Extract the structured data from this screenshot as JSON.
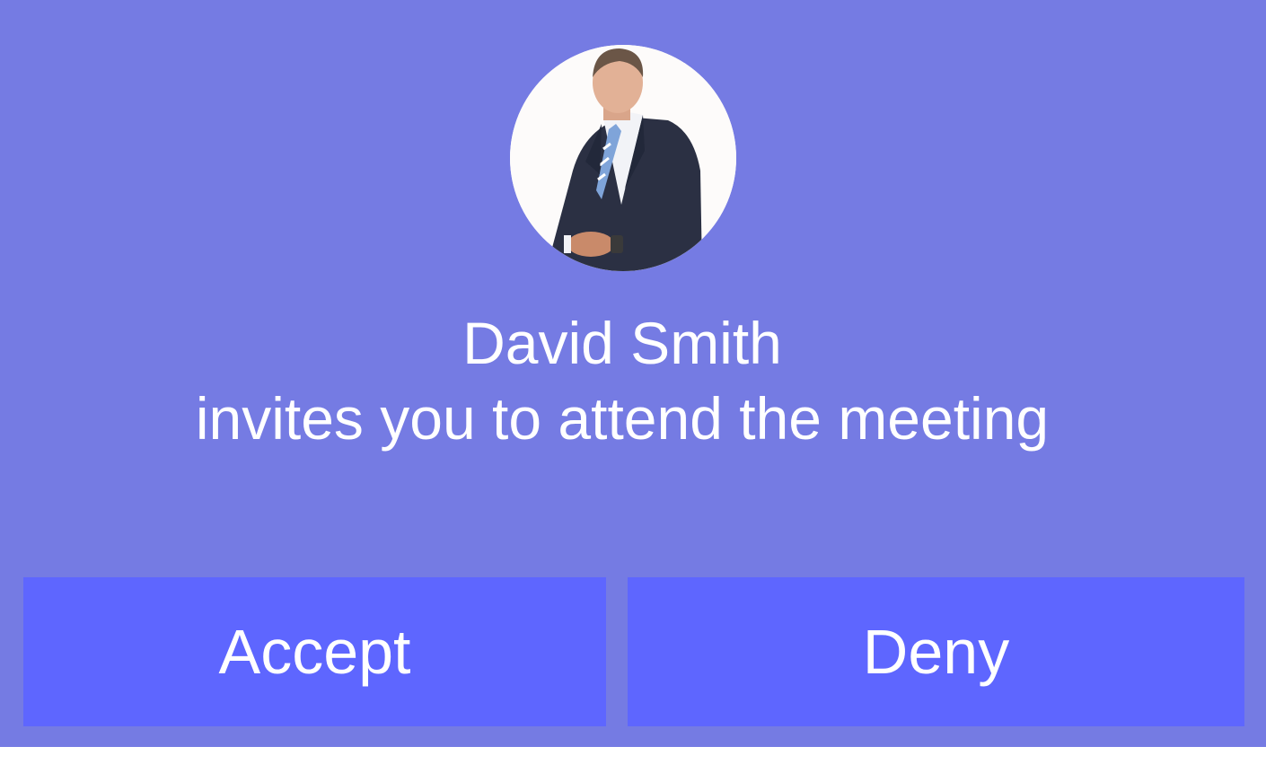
{
  "invite": {
    "caller_name": "David Smith",
    "message": "invites you to attend the meeting",
    "avatar_icon": "caller-avatar-photo"
  },
  "actions": {
    "accept_label": "Accept",
    "deny_label": "Deny"
  },
  "colors": {
    "background": "#757be3",
    "button": "#5e66ff",
    "text": "#ffffff"
  }
}
